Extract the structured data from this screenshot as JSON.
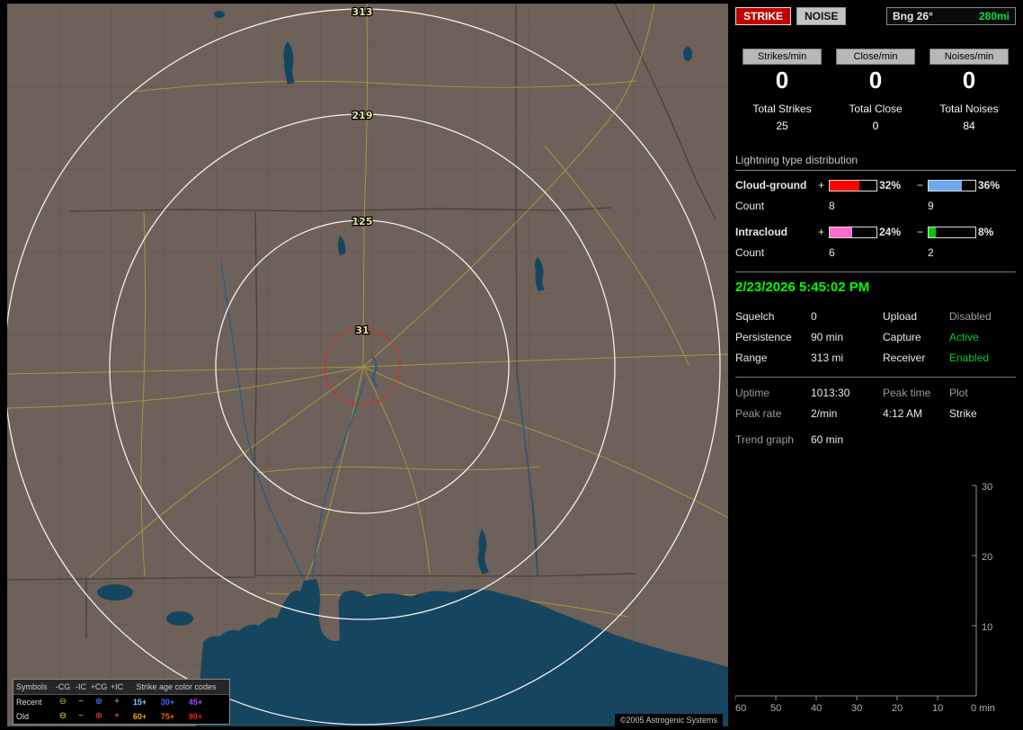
{
  "map": {
    "range_labels": [
      "313",
      "219",
      "125",
      "31"
    ],
    "range_ring_color": "#f0f0f0",
    "alert_ring_color": "#ee2222",
    "copyright": "©2005 Astrogenic Systems",
    "legend": {
      "header": {
        "symbols": "Symbols",
        "cg_neg": "-CG",
        "ic_neg": "-IC",
        "cg_pos": "+CG",
        "ic_pos": "+IC",
        "age_title": "Strike age color codes"
      },
      "rows": [
        {
          "label": "Recent",
          "symbols": [
            {
              "char": "⊖",
              "color": "#9adf2a"
            },
            {
              "char": "−",
              "color": "#c8c8c8"
            },
            {
              "char": "⊕",
              "color": "#4e8cff"
            },
            {
              "char": "+",
              "color": "#7fb2ff"
            }
          ],
          "ages": [
            {
              "text": "15+",
              "color": "#6fc8ff"
            },
            {
              "text": "30+",
              "color": "#3f6cff"
            },
            {
              "text": "45+",
              "color": "#a04cff"
            }
          ]
        },
        {
          "label": "Old",
          "symbols": [
            {
              "char": "⊖",
              "color": "#ffe800"
            },
            {
              "char": "−",
              "color": "#e0b400"
            },
            {
              "char": "⊕",
              "color": "#ff4040"
            },
            {
              "char": "+",
              "color": "#ff6a5a"
            }
          ],
          "ages": [
            {
              "text": "60+",
              "color": "#ffa000"
            },
            {
              "text": "75+",
              "color": "#ff5a00"
            },
            {
              "text": "90+",
              "color": "#ff1e1e"
            }
          ]
        }
      ]
    }
  },
  "panel": {
    "strike_button": "STRIKE",
    "noise_button": "NOISE",
    "bearing_label": "Bng 26°",
    "bearing_range": "280mi",
    "rate_boxes": [
      {
        "label": "Strikes/min",
        "value": "0",
        "total_label": "Total Strikes",
        "total": "25"
      },
      {
        "label": "Close/min",
        "value": "0",
        "total_label": "Total Close",
        "total": "0"
      },
      {
        "label": "Noises/min",
        "value": "0",
        "total_label": "Total Noises",
        "total": "84"
      }
    ],
    "distribution": {
      "title": "Lightning type distribution",
      "plus_sign": "+",
      "minus_sign": "−",
      "count_label": "Count",
      "rows": [
        {
          "name": "Cloud-ground",
          "pos_pct": "32%",
          "neg_pct": "36%",
          "pos_count": "8",
          "neg_count": "9",
          "pos_color": "#ff0000",
          "neg_color": "#6aaaf0",
          "pos_fill": 64,
          "neg_fill": 72
        },
        {
          "name": "Intracloud",
          "pos_pct": "24%",
          "neg_pct": "8%",
          "pos_count": "6",
          "neg_count": "2",
          "pos_color": "#ff6ad0",
          "neg_color": "#00cc00",
          "pos_fill": 48,
          "neg_fill": 16
        }
      ]
    },
    "datetime": "2/23/2026 5:45:02 PM",
    "datetime_color": "#00ff00",
    "status": {
      "rows": [
        {
          "label1": "Squelch",
          "value1": "0",
          "label2": "Upload",
          "value2": "Disabled",
          "value2_hex": "#9a9a9a"
        },
        {
          "label1": "Persistence",
          "value1": "90 min",
          "label2": "Capture",
          "value2": "Active",
          "value2_hex": "#00cc33"
        },
        {
          "label1": "Range",
          "value1": "313 mi",
          "label2": "Receiver",
          "value2": "Enabled",
          "value2_hex": "#00cc33"
        }
      ]
    },
    "stats": {
      "uptime_label": "Uptime",
      "uptime": "1013:30",
      "peak_time_label": "Peak time",
      "plot_label": "Plot",
      "peak_rate_label": "Peak rate",
      "peak_rate": "2/min",
      "peak_time": "4:12 AM",
      "plot": "Strike"
    },
    "trend": {
      "label": "Trend graph",
      "value": "60 min",
      "y_ticks": [
        "30",
        "20",
        "10"
      ],
      "x_ticks": [
        "60",
        "50",
        "40",
        "30",
        "20",
        "10"
      ],
      "origin_label": "0 min"
    }
  }
}
